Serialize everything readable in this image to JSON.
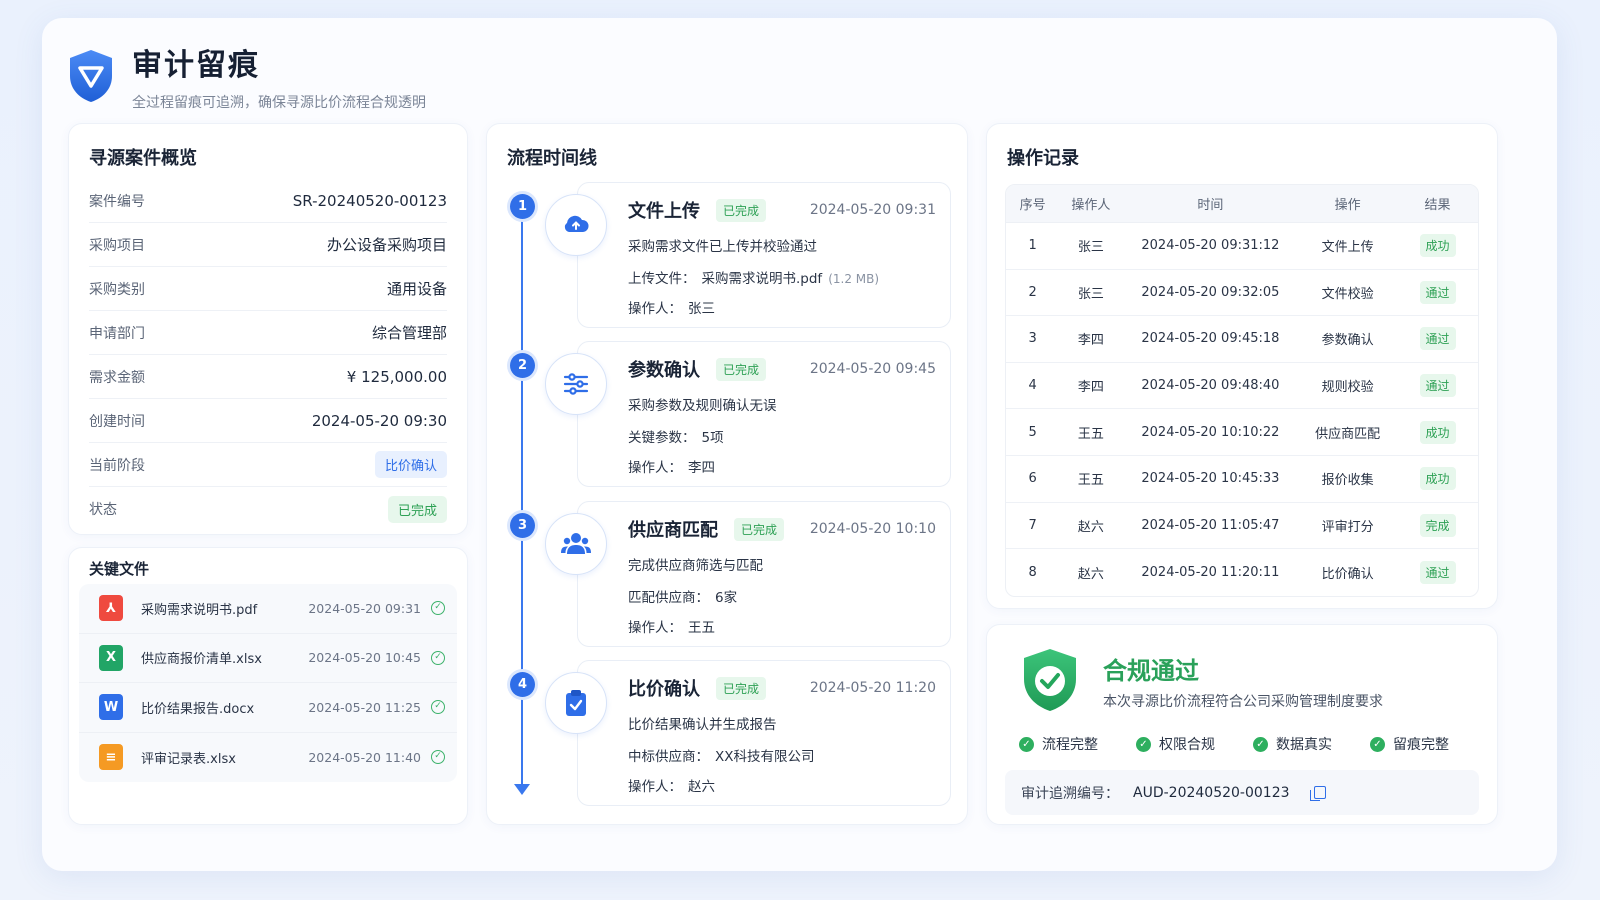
{
  "header": {
    "title": "审计留痕",
    "subtitle": "全过程留痕可追溯，确保寻源比价流程合规透明"
  },
  "overview": {
    "title": "寻源案件概览",
    "rows": [
      {
        "label": "案件编号",
        "value": "SR-20240520-00123"
      },
      {
        "label": "采购项目",
        "value": "办公设备采购项目"
      },
      {
        "label": "采购类别",
        "value": "通用设备"
      },
      {
        "label": "申请部门",
        "value": "综合管理部"
      },
      {
        "label": "需求金额",
        "value": "¥ 125,000.00"
      },
      {
        "label": "创建时间",
        "value": "2024-05-20 09:30"
      },
      {
        "label": "当前阶段",
        "value": "比价确认"
      },
      {
        "label": "状态",
        "value": "已完成"
      }
    ]
  },
  "files": {
    "title": "关键文件",
    "items": [
      {
        "name": "采购需求说明书.pdf",
        "time": "2024-05-20 09:31",
        "type": "pdf",
        "glyph": "⅄",
        "color": "#ef4a3f"
      },
      {
        "name": "供应商报价清单.xlsx",
        "time": "2024-05-20 10:45",
        "type": "excel",
        "glyph": "X",
        "color": "#21a566"
      },
      {
        "name": "比价结果报告.docx",
        "time": "2024-05-20 11:25",
        "type": "word",
        "glyph": "W",
        "color": "#2f6ee8"
      },
      {
        "name": "评审记录表.xlsx",
        "time": "2024-05-20 11:40",
        "type": "sheet",
        "glyph": "≡",
        "color": "#f59a23"
      }
    ]
  },
  "timeline": {
    "title": "流程时间线",
    "steps": [
      {
        "num": "1",
        "title": "文件上传",
        "status": "已完成",
        "time": "2024-05-20 09:31",
        "desc": "采购需求文件已上传并校验通过",
        "l1_label": "上传文件：",
        "l1_value": "采购需求说明书.pdf",
        "l1_extra": "(1.2 MB)",
        "l2_label": "操作人：",
        "l2_value": "张三",
        "icon": "cloud-upload-icon"
      },
      {
        "num": "2",
        "title": "参数确认",
        "status": "已完成",
        "time": "2024-05-20 09:45",
        "desc": "采购参数及规则确认无误",
        "l1_label": "关键参数：",
        "l1_value": "5项",
        "l1_extra": "",
        "l2_label": "操作人：",
        "l2_value": "李四",
        "icon": "sliders-icon"
      },
      {
        "num": "3",
        "title": "供应商匹配",
        "status": "已完成",
        "time": "2024-05-20 10:10",
        "desc": "完成供应商筛选与匹配",
        "l1_label": "匹配供应商：",
        "l1_value": "6家",
        "l1_extra": "",
        "l2_label": "操作人：",
        "l2_value": "王五",
        "icon": "users-icon"
      },
      {
        "num": "4",
        "title": "比价确认",
        "status": "已完成",
        "time": "2024-05-20 11:20",
        "desc": "比价结果确认并生成报告",
        "l1_label": "中标供应商：",
        "l1_value": "XX科技有限公司",
        "l1_extra": "",
        "l2_label": "操作人：",
        "l2_value": "赵六",
        "icon": "clipboard-check-icon"
      }
    ]
  },
  "log": {
    "title": "操作记录",
    "columns": [
      "序号",
      "操作人",
      "时间",
      "操作",
      "结果"
    ],
    "rows": [
      [
        "1",
        "张三",
        "2024-05-20 09:31:12",
        "文件上传",
        "成功"
      ],
      [
        "2",
        "张三",
        "2024-05-20 09:32:05",
        "文件校验",
        "通过"
      ],
      [
        "3",
        "李四",
        "2024-05-20 09:45:18",
        "参数确认",
        "通过"
      ],
      [
        "4",
        "李四",
        "2024-05-20 09:48:40",
        "规则校验",
        "通过"
      ],
      [
        "5",
        "王五",
        "2024-05-20 10:10:22",
        "供应商匹配",
        "成功"
      ],
      [
        "6",
        "王五",
        "2024-05-20 10:45:33",
        "报价收集",
        "成功"
      ],
      [
        "7",
        "赵六",
        "2024-05-20 11:05:47",
        "评审打分",
        "完成"
      ],
      [
        "8",
        "赵六",
        "2024-05-20 11:20:11",
        "比价确认",
        "通过"
      ]
    ]
  },
  "compliance": {
    "title": "合规通过",
    "subtitle": "本次寻源比价流程符合公司采购管理制度要求",
    "checks": [
      "流程完整",
      "权限合规",
      "数据真实",
      "留痕完整"
    ],
    "trace_label": "审计追溯编号：",
    "trace_value": "AUD-20240520-00123"
  },
  "colors": {
    "accent": "#2f6ee8",
    "success": "#2ea155"
  }
}
